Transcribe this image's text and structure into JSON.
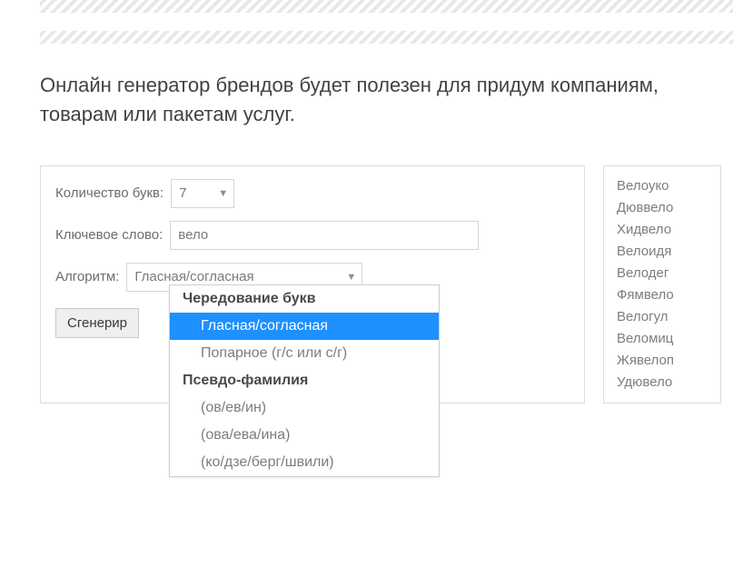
{
  "intro": "Онлайн генератор брендов будет полезен для придум компаниям, товарам или пакетам услуг.",
  "form": {
    "count_label": "Количество букв:",
    "count_value": "7",
    "keyword_label": "Ключевое слово:",
    "keyword_value": "вело",
    "algo_label": "Алгоритм:",
    "algo_value": "Гласная/согласная",
    "generate_label": "Сгенерир"
  },
  "dropdown": {
    "group1": "Чередование букв",
    "opt1": "Гласная/согласная",
    "opt2": "Попарное (г/с или с/г)",
    "group2": "Псевдо-фамилия",
    "opt3": "(ов/ев/ин)",
    "opt4": "(ова/ева/ина)",
    "opt5": "(ко/дзе/берг/швили)"
  },
  "results": [
    "Велоуко",
    "Дюввело",
    "Хидвело",
    "Велоидя",
    "Велодег",
    "Фямвело",
    "Велогул",
    "Веломиц",
    "Жявелоп",
    "Удювело"
  ]
}
